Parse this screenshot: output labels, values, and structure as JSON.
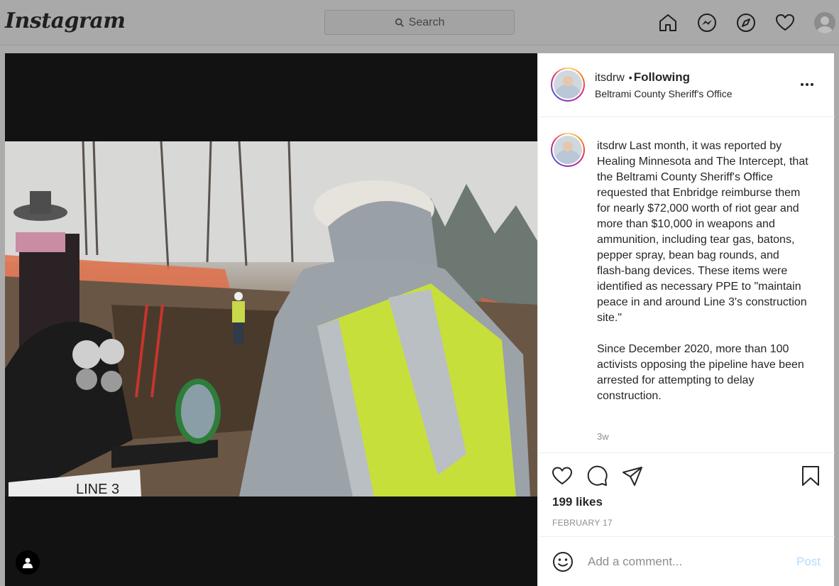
{
  "header": {
    "logo": "Instagram",
    "search_placeholder": "Search"
  },
  "post": {
    "author": "itsdrw",
    "follow_status": "Following",
    "location": "Beltrami County Sheriff's Office",
    "caption": "Last month, it was reported by Healing Minnesota and The Intercept, that the Beltrami County Sheriff's Office requested that Enbridge reimburse them for nearly $72,000 worth of riot gear and more than $10,000 in weapons and ammunition, including tear gas, batons, pepper spray, bean bag rounds, and flash-bang devices. These items were identified as necessary PPE to \"maintain peace in and around Line 3's construction site.\"\n\nSince December 2020, more than 100 activists opposing the pipeline have been arrested for attempting to delay construction.",
    "time_ago": "3w",
    "likes": "199 likes",
    "date": "FEBRUARY 17",
    "comment_placeholder": "Add a comment...",
    "post_label": "Post"
  },
  "photo": {
    "sign_text": "LINE 3"
  },
  "colors": {
    "post_button": "#b3dbff",
    "backdrop": "#ababab"
  },
  "icons": [
    "search-icon",
    "home-icon",
    "messenger-icon",
    "explore-icon",
    "heart-icon",
    "profile-icon",
    "more-icon",
    "like-icon",
    "comment-icon",
    "share-icon",
    "save-icon",
    "emoji-icon",
    "user-tag-icon"
  ]
}
